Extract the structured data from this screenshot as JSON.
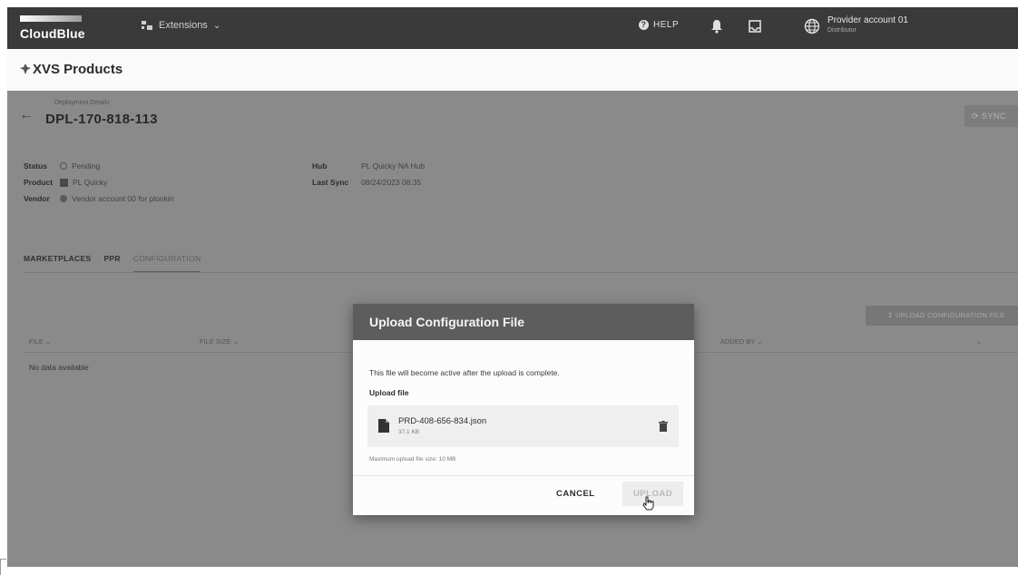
{
  "topbar": {
    "logo": "CloudBlue",
    "extensions_label": "Extensions",
    "help_label": "HELP",
    "account_name": "Provider account 01",
    "account_role": "Distributor"
  },
  "product_title": "XVS Products",
  "deployment": {
    "label": "Deployment Details",
    "id": "DPL-170-818-113",
    "sync_label": "SYNC",
    "status_key": "Status",
    "status_value": "Pending",
    "product_key": "Product",
    "product_value": "PL Quicky",
    "vendor_key": "Vendor",
    "vendor_value": "Vendor account 00 for plonkin",
    "hub_key": "Hub",
    "hub_value": "PL Quicky NA Hub",
    "lastsync_key": "Last Sync",
    "lastsync_value": "08/24/2023 08:35"
  },
  "tabs": [
    "MARKETPLACES",
    "PPR",
    "CONFIGURATION"
  ],
  "upload_config_button": "UPLOAD CONFIGURATION FILE",
  "table": {
    "headers": [
      "FILE",
      "FILE SIZE",
      "ADDED BY"
    ],
    "empty": "No data available"
  },
  "modal": {
    "title": "Upload Configuration File",
    "note": "This file will become active after the upload is complete.",
    "upload_label": "Upload file",
    "file_name": "PRD-408-656-834.json",
    "file_size": "37.1 KB",
    "max_size": "Maximum upload file size: 10 MB",
    "cancel": "CANCEL",
    "upload": "UPLOAD"
  },
  "colors": {
    "topbar": "#3a3a3a",
    "overlay": "#8a8a8a",
    "modal_header": "#5d5d5d"
  }
}
